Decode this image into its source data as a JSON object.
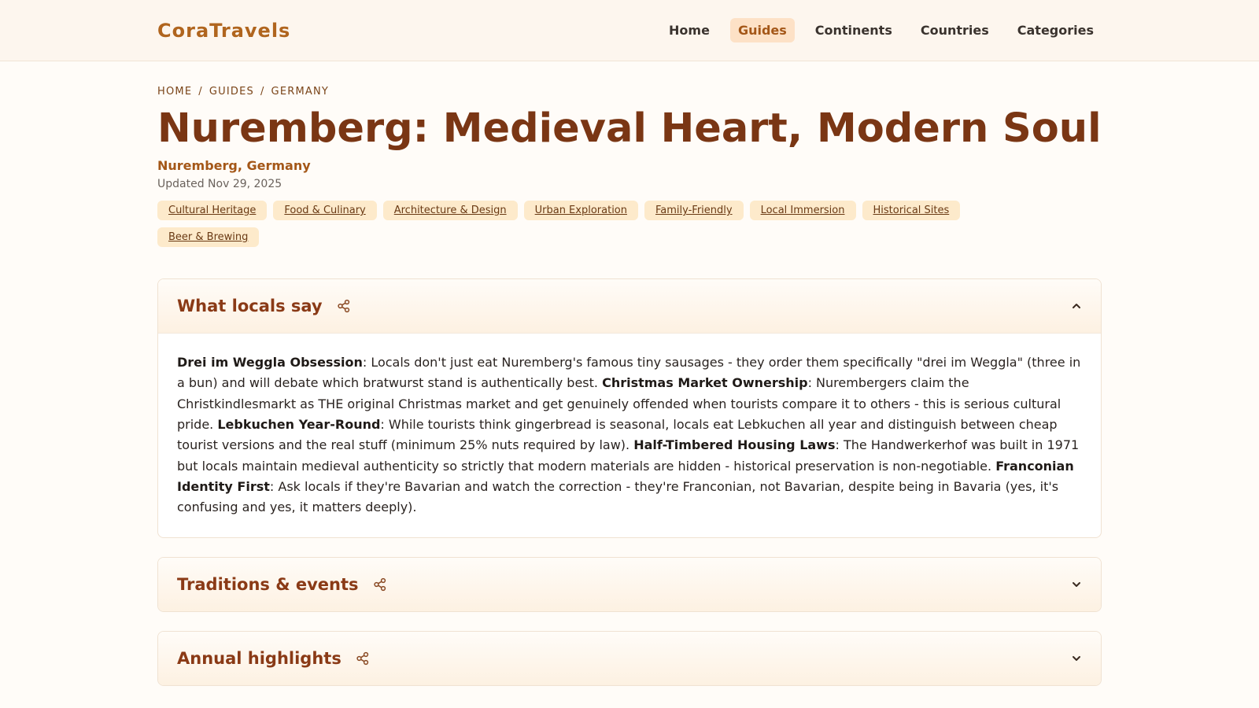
{
  "header": {
    "brand": "CoraTravels",
    "nav": [
      {
        "label": "Home",
        "active": false
      },
      {
        "label": "Guides",
        "active": true
      },
      {
        "label": "Continents",
        "active": false
      },
      {
        "label": "Countries",
        "active": false
      },
      {
        "label": "Categories",
        "active": false
      }
    ]
  },
  "breadcrumb": [
    "HOME",
    "GUIDES",
    "GERMANY"
  ],
  "page": {
    "title": "Nuremberg: Medieval Heart, Modern Soul",
    "location": "Nuremberg, Germany",
    "updated": "Updated Nov 29, 2025"
  },
  "tags": [
    "Cultural Heritage",
    "Food & Culinary",
    "Architecture & Design",
    "Urban Exploration",
    "Family-Friendly",
    "Local Immersion",
    "Historical Sites",
    "Beer & Brewing"
  ],
  "sections": [
    {
      "title": "What locals say",
      "expanded": true,
      "body": [
        {
          "bold": "Drei im Weggla Obsession",
          "text": ": Locals don't just eat Nuremberg's famous tiny sausages - they order them specifically \"drei im Weggla\" (three in a bun) and will debate which bratwurst stand is authentically best. "
        },
        {
          "bold": "Christmas Market Ownership",
          "text": ": Nurembergers claim the Christkindlesmarkt as THE original Christmas market and get genuinely offended when tourists compare it to others - this is serious cultural pride. "
        },
        {
          "bold": "Lebkuchen Year-Round",
          "text": ": While tourists think gingerbread is seasonal, locals eat Lebkuchen all year and distinguish between cheap tourist versions and the real stuff (minimum 25% nuts required by law). "
        },
        {
          "bold": "Half-Timbered Housing Laws",
          "text": ": The Handwerkerhof was built in 1971 but locals maintain medieval authenticity so strictly that modern materials are hidden - historical preservation is non-negotiable. "
        },
        {
          "bold": "Franconian Identity First",
          "text": ": Ask locals if they're Bavarian and watch the correction - they're Franconian, not Bavarian, despite being in Bavaria (yes, it's confusing and yes, it matters deeply)."
        }
      ]
    },
    {
      "title": "Traditions & events",
      "expanded": false,
      "body": []
    },
    {
      "title": "Annual highlights",
      "expanded": false,
      "body": []
    }
  ],
  "colors": {
    "brand": "#b0651e",
    "title": "#7a3614",
    "accent_bg": "#fde1c6",
    "tag_bg": "#fdeacb"
  },
  "icons": {
    "share": "share-icon",
    "expanded": "chevron-up-icon",
    "collapsed": "chevron-down-icon"
  }
}
